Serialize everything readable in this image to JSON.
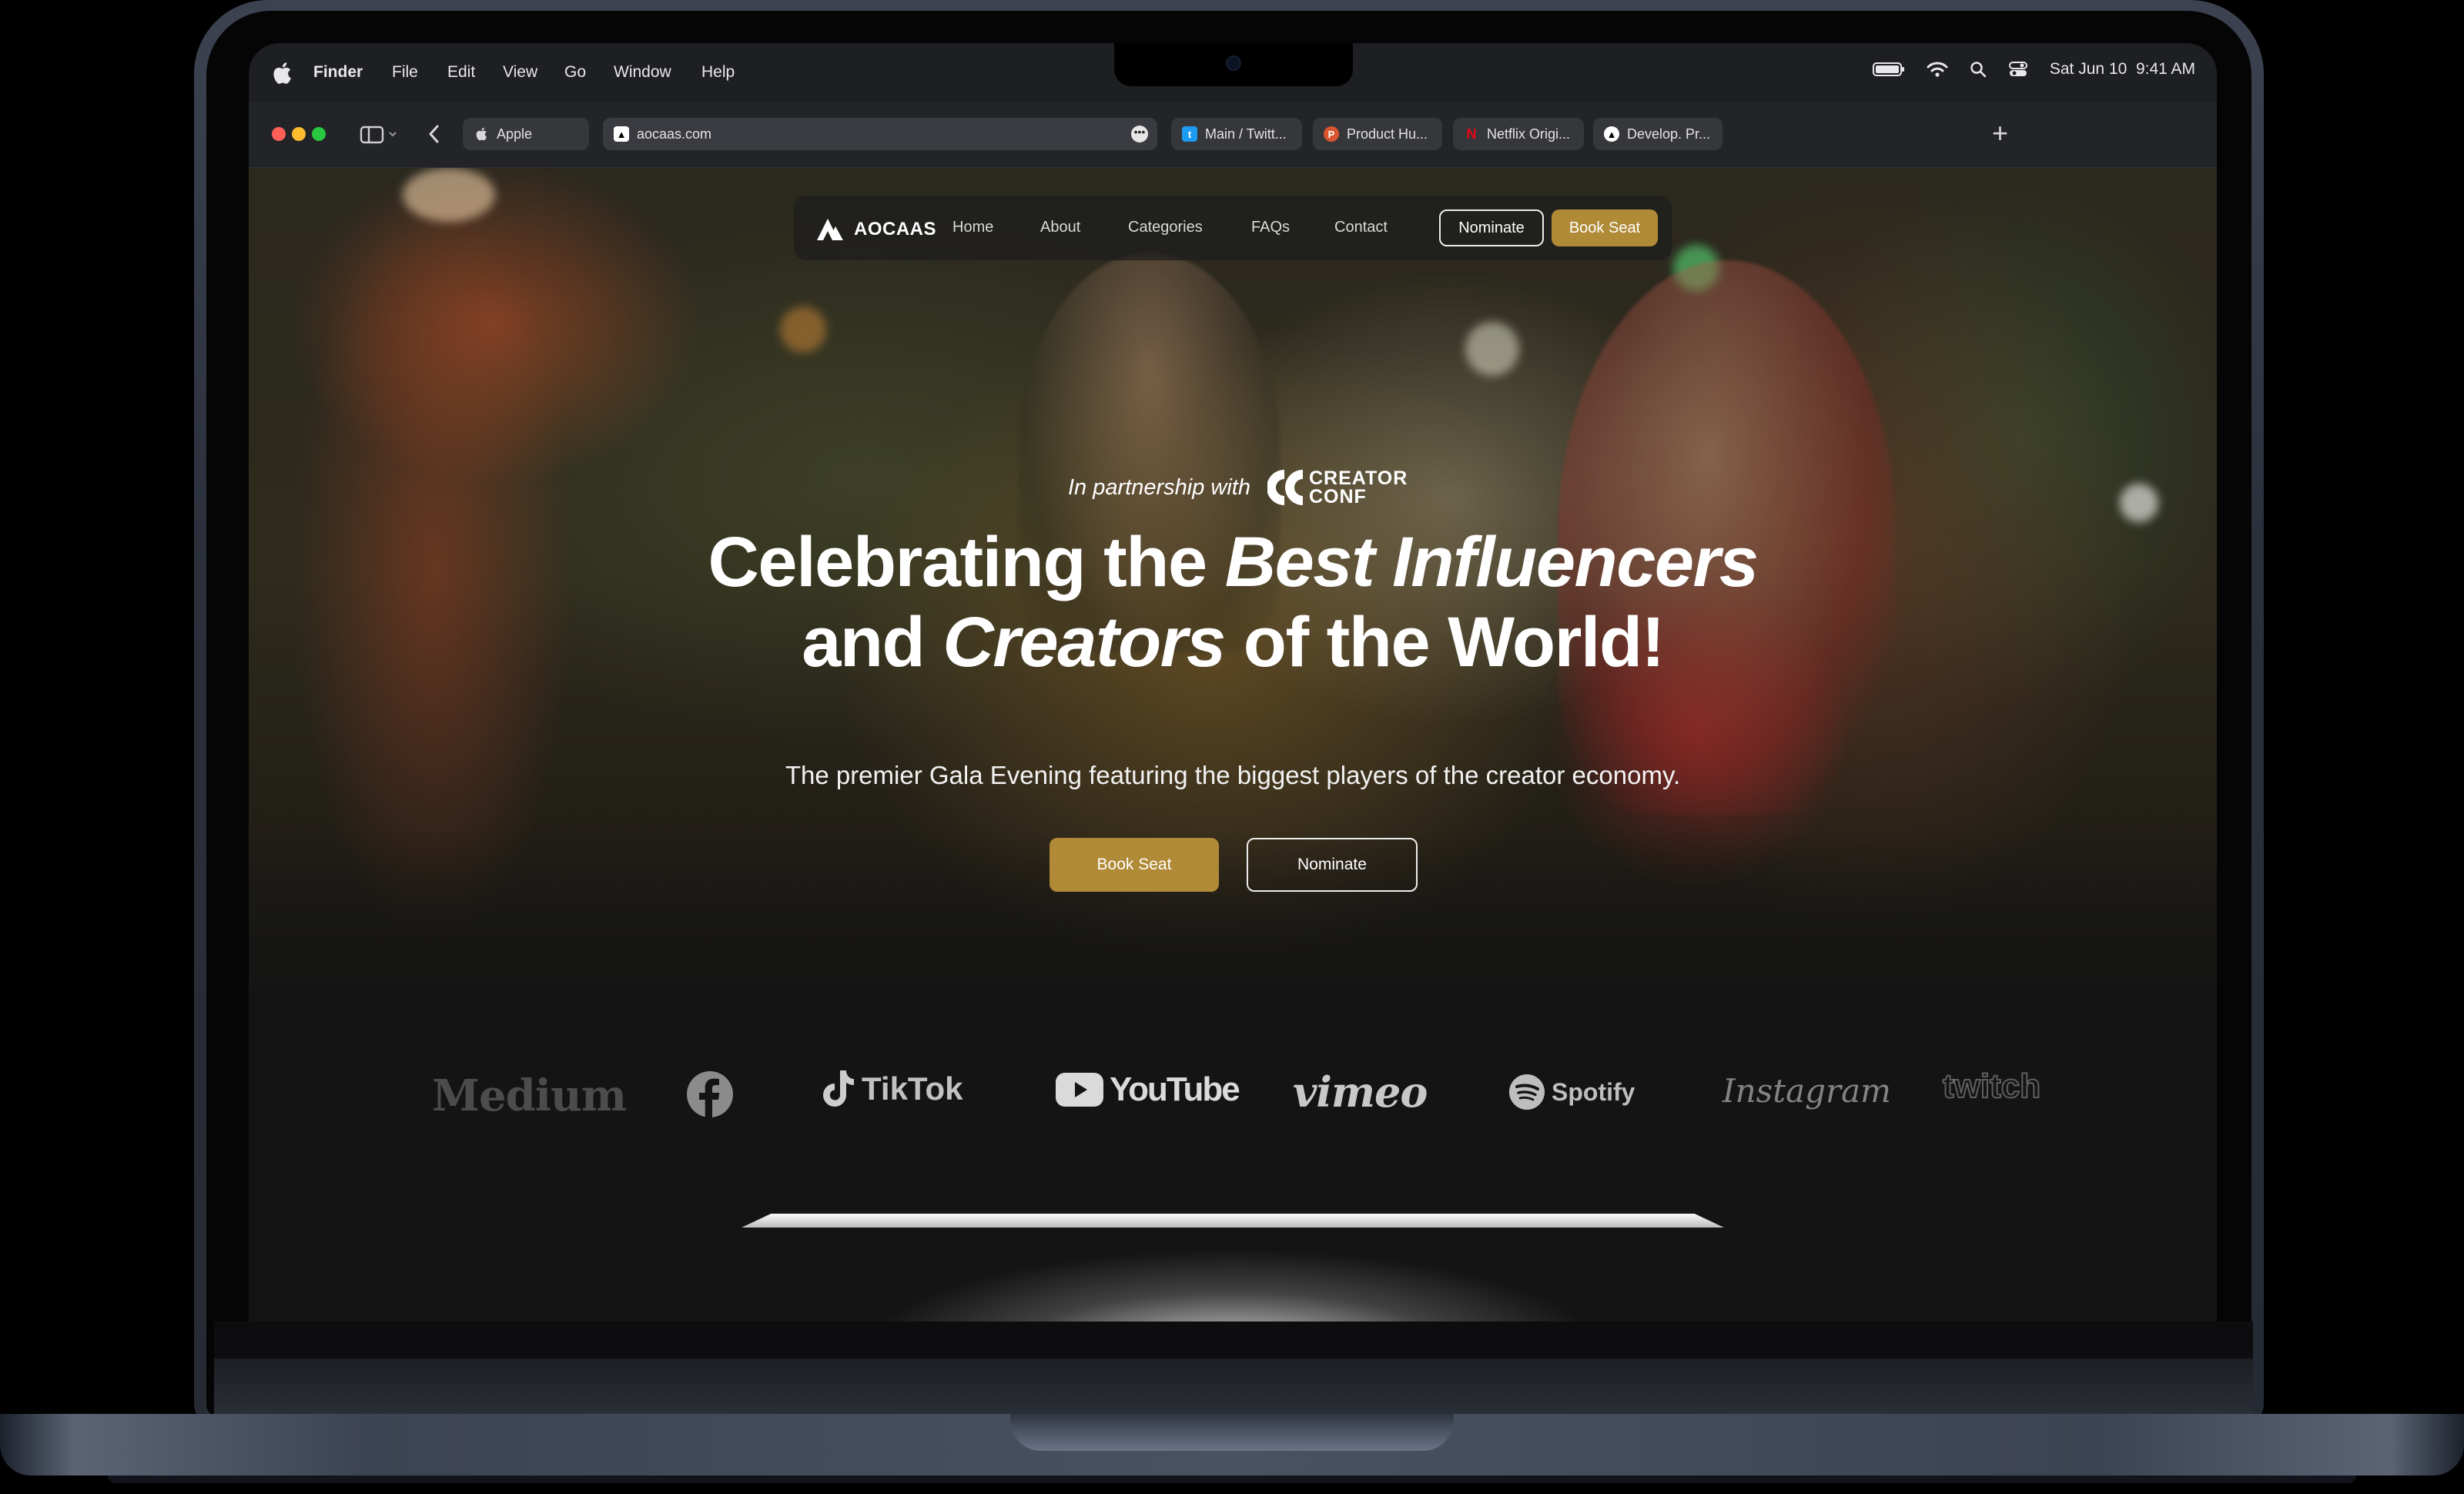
{
  "menubar": {
    "app": "Finder",
    "items": [
      "File",
      "Edit",
      "View",
      "Go",
      "Window",
      "Help"
    ],
    "datetime": "Sat Jun 10  9:41 AM"
  },
  "browser": {
    "tabs": [
      {
        "label": "Apple",
        "icon": "apple-icon"
      },
      {
        "label": "aocaas.com",
        "icon": "aocaas-favicon",
        "active": true
      },
      {
        "label": "Main / Twitt...",
        "icon": "twitter-icon"
      },
      {
        "label": "Product Hu...",
        "icon": "product-hunt-icon"
      },
      {
        "label": "Netflix Origi...",
        "icon": "netflix-icon"
      },
      {
        "label": "Develop. Pr...",
        "icon": "develop-icon"
      }
    ],
    "new_tab": "+"
  },
  "site": {
    "logo": "AOCAAS",
    "nav": [
      "Home",
      "About",
      "Categories",
      "FAQs",
      "Contact"
    ],
    "nominate": "Nominate",
    "book_seat": "Book Seat",
    "partner_text": "In partnership with",
    "partner_logo_line1": "CREATOR",
    "partner_logo_line2": "CONF",
    "headline": {
      "part1": "Celebrating the ",
      "em1": "Best Influencers",
      "part2": "and ",
      "em2": "Creators",
      "part3": " of the World!"
    },
    "subheadline": "The premier Gala Evening featuring the biggest players of the creator economy.",
    "cta_primary": "Book Seat",
    "cta_secondary": "Nominate",
    "brands": [
      "Medium",
      "Facebook",
      "TikTok",
      "YouTube",
      "vimeo",
      "Spotify",
      "Instagram",
      "twitch"
    ]
  },
  "colors": {
    "gold": "#b08a36",
    "menubar": "#1e1f22",
    "toolbar": "#232427"
  }
}
